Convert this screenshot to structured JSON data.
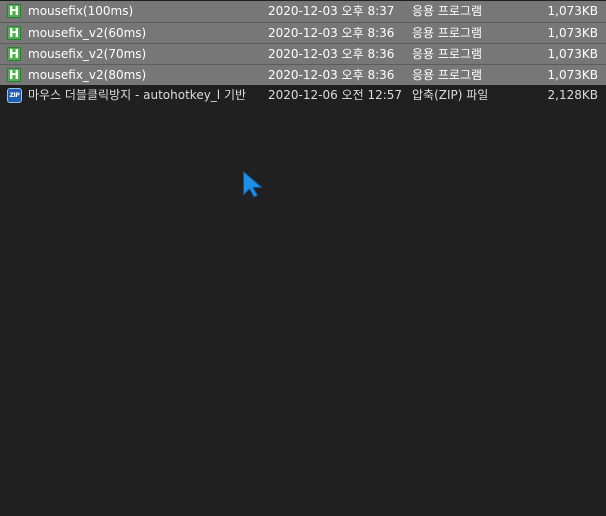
{
  "files": [
    {
      "name": "mousefix(100ms)",
      "date": "2020-12-03 오후 8:37",
      "type": "응용 프로그램",
      "size": "1,073KB",
      "icon": "autohotkey-exe-icon",
      "icon_letter": "H",
      "selected": true
    },
    {
      "name": "mousefix_v2(60ms)",
      "date": "2020-12-03 오후 8:36",
      "type": "응용 프로그램",
      "size": "1,073KB",
      "icon": "autohotkey-exe-icon",
      "icon_letter": "H",
      "selected": true
    },
    {
      "name": "mousefix_v2(70ms)",
      "date": "2020-12-03 오후 8:36",
      "type": "응용 프로그램",
      "size": "1,073KB",
      "icon": "autohotkey-exe-icon",
      "icon_letter": "H",
      "selected": true
    },
    {
      "name": "mousefix_v2(80ms)",
      "date": "2020-12-03 오후 8:36",
      "type": "응용 프로그램",
      "size": "1,073KB",
      "icon": "autohotkey-exe-icon",
      "icon_letter": "H",
      "selected": true
    },
    {
      "name": "마우스 더블클릭방지 - autohotkey_l 기반",
      "date": "2020-12-06 오전 12:57",
      "type": "압축(ZIP) 파일",
      "size": "2,128KB",
      "icon": "zip-archive-icon",
      "icon_letter": "ZIP",
      "selected": false
    }
  ],
  "colors": {
    "background": "#202020",
    "selection": "#777777",
    "text": "#dcdcdc",
    "cursor": "#1f8fe6"
  }
}
